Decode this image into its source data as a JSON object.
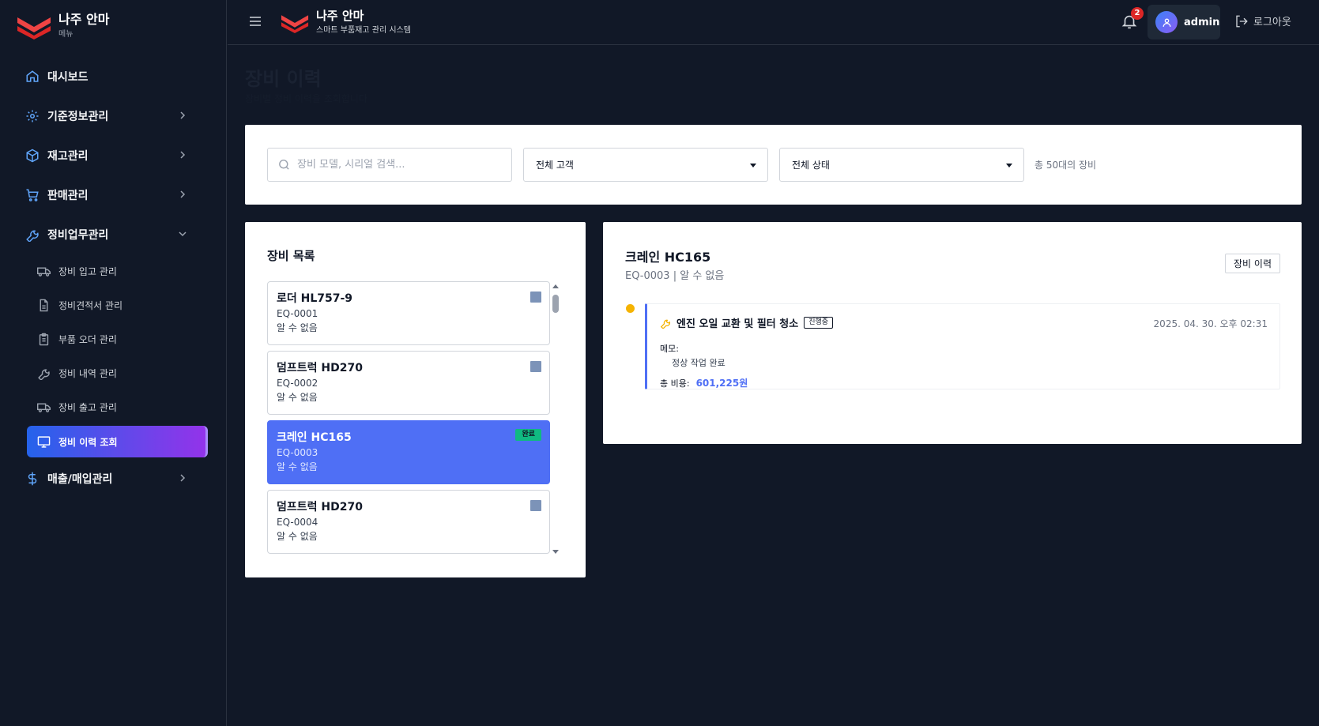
{
  "brand": {
    "title": "나주 안마",
    "menu_caption": "메뉴",
    "system_name": "스마트 부품재고 관리 시스템"
  },
  "sidebar": {
    "items": [
      {
        "label": "대시보드",
        "icon": "home-icon"
      },
      {
        "label": "기준정보관리",
        "icon": "gear-icon"
      },
      {
        "label": "재고관리",
        "icon": "box-icon"
      },
      {
        "label": "판매관리",
        "icon": "cart-icon"
      },
      {
        "label": "정비업무관리",
        "icon": "wrench-icon"
      },
      {
        "label": "매출/매입관리",
        "icon": "dollar-icon"
      }
    ],
    "sub_items": [
      {
        "label": "장비 입고 관리",
        "icon": "truck-icon"
      },
      {
        "label": "정비견적서 관리",
        "icon": "document-icon"
      },
      {
        "label": "부품 오더 관리",
        "icon": "clipboard-icon"
      },
      {
        "label": "정비 내역 관리",
        "icon": "wrench-icon"
      },
      {
        "label": "장비 출고 관리",
        "icon": "truck-icon"
      },
      {
        "label": "정비 이력 조회",
        "icon": "monitor-icon"
      }
    ]
  },
  "header": {
    "notification_count": "2",
    "user_name": "admin",
    "logout_label": "로그아웃"
  },
  "page": {
    "title": "장비 이력",
    "description": "장비별 정비 이력을 조회합니다"
  },
  "filters": {
    "search_placeholder": "장비 모델, 시리얼 검색...",
    "customer_select": "전체 고객",
    "status_select": "전체 상태",
    "total_text": "총 50대의 장비"
  },
  "equipment_list": {
    "title": "장비 목록",
    "items": [
      {
        "name": "로더 HL757-9",
        "code": "EQ-0001",
        "customer": "알 수 없음"
      },
      {
        "name": "덤프트럭 HD270",
        "code": "EQ-0002",
        "customer": "알 수 없음"
      },
      {
        "name": "크레인 HC165",
        "code": "EQ-0003",
        "customer": "알 수 없음",
        "badge": "완료"
      },
      {
        "name": "덤프트럭 HD270",
        "code": "EQ-0004",
        "customer": "알 수 없음"
      }
    ]
  },
  "detail": {
    "title": "크레인 HC165",
    "subtitle": "EQ-0003 | 알 수 없음",
    "history_button": "장비 이력",
    "record": {
      "title": "엔진 오일 교환 및 필터 청소",
      "status": "진행중",
      "date": "2025. 04. 30. 오후 02:31",
      "memo_label": "메모:",
      "memo": "정상 작업 완료",
      "cost_label": "총 비용:",
      "cost": "601,225원"
    }
  },
  "colors": {
    "accent": "#4f6ff5",
    "sidebar_bg": "#111827",
    "active_gradient_start": "#2563eb",
    "active_gradient_end": "#9333ea",
    "brand_red": "#ef4444",
    "badge_green": "#10b981",
    "timeline_dot": "#f5b301"
  }
}
